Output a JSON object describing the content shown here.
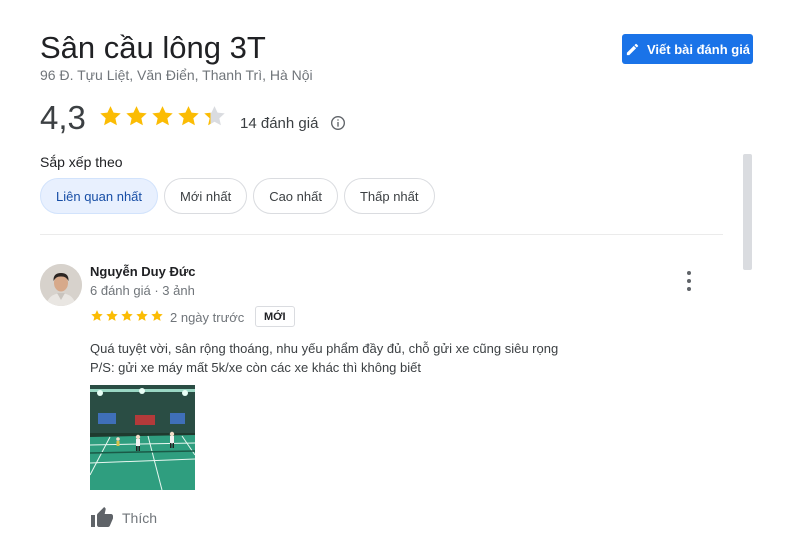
{
  "place": {
    "name": "Sân cầu lông 3T",
    "address": "96 Đ. Tựu Liệt, Văn Điển, Thanh Trì, Hà Nội"
  },
  "write_review_label": "Viết bài đánh giá",
  "summary": {
    "rating_text": "4,3",
    "rating_value": 4.3,
    "count_text": "14 đánh giá"
  },
  "sort": {
    "label": "Sắp xếp theo",
    "options": [
      "Liên quan nhất",
      "Mới nhất",
      "Cao nhất",
      "Thấp nhất"
    ],
    "selected": "Liên quan nhất"
  },
  "review": {
    "author": "Nguyễn Duy Đức",
    "meta": "6 đánh giá · 3 ảnh",
    "stars": 5,
    "date": "2 ngày trước",
    "badge": "MỚI",
    "text_line1": "Quá tuyệt vời, sân rộng thoáng, nhu yếu phẩm đầy đủ, chỗ gửi xe cũng siêu rọng",
    "text_line2": "P/S: gửi xe máy mất 5k/xe còn các xe khác thì không biết",
    "like_label": "Thích"
  },
  "colors": {
    "accent": "#1a73e8",
    "star": "#fbbc04",
    "star_empty": "#dadce0",
    "chip_active_bg": "#e8f0fe"
  },
  "icons": [
    "pencil-icon",
    "star-icon",
    "info-icon",
    "more-vert-icon",
    "thumb-up-icon"
  ]
}
